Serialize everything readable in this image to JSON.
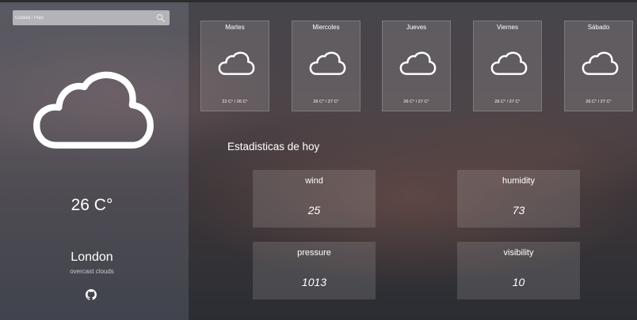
{
  "search": {
    "placeholder": "Ciudad / País"
  },
  "current": {
    "temp": "26 C°",
    "city": "London",
    "description": "overcast clouds",
    "icon": "cloud-icon"
  },
  "forecast": [
    {
      "day": "Martes",
      "range": "22 C° / 26 C°",
      "icon": "cloud-icon"
    },
    {
      "day": "Miercoles",
      "range": "26 C° / 27 C°",
      "icon": "cloud-icon"
    },
    {
      "day": "Jueves",
      "range": "26 C° / 27 C°",
      "icon": "cloud-icon"
    },
    {
      "day": "Viernes",
      "range": "26 C° / 27 C°",
      "icon": "cloud-icon"
    },
    {
      "day": "Sábado",
      "range": "26 C° / 27 C°",
      "icon": "cloud-icon"
    }
  ],
  "stats": {
    "title": "Estadisticas de hoy",
    "items": [
      {
        "label": "wind",
        "value": "25"
      },
      {
        "label": "humidity",
        "value": "73"
      },
      {
        "label": "pressure",
        "value": "1013"
      },
      {
        "label": "visibility",
        "value": "10"
      }
    ]
  },
  "footer": {
    "icon": "github-icon"
  }
}
